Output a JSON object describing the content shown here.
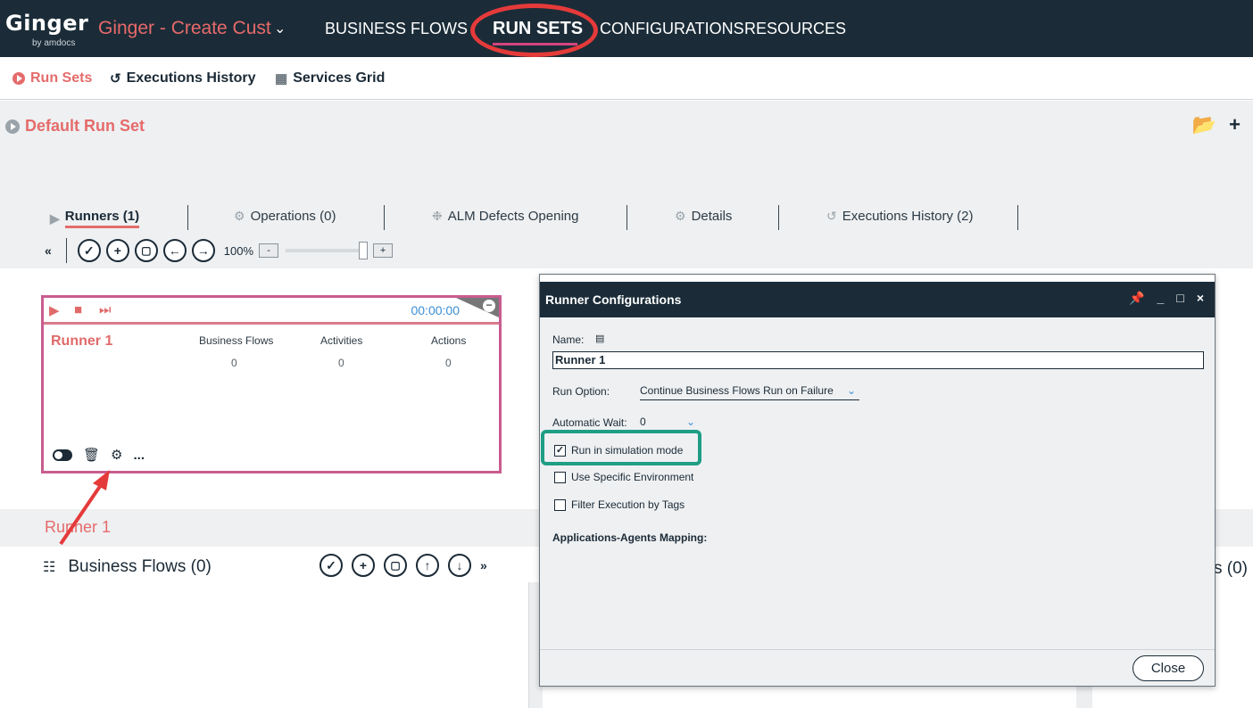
{
  "app": {
    "logo": "Ginger",
    "logo_sub": "by amdocs",
    "solution_name": "Ginger - Create Cust"
  },
  "topnav": {
    "items": [
      "BUSINESS FLOWS",
      "RUN SETS",
      "CONFIGURATIONS",
      "RESOURCES"
    ],
    "active": "RUN SETS"
  },
  "subnav": {
    "run_sets": "Run Sets",
    "executions_history": "Executions History",
    "services_grid": "Services Grid"
  },
  "runset": {
    "title": "Default Run Set"
  },
  "tabs": {
    "runners": "Runners (1)",
    "operations": "Operations (0)",
    "alm": "ALM Defects Opening",
    "details": "Details",
    "history": "Executions History (2)"
  },
  "toolbar": {
    "zoom": "100%",
    "zoom_minus": "-",
    "zoom_plus": "+"
  },
  "runner_card": {
    "time": "00:00:00",
    "name": "Runner 1",
    "stats": [
      {
        "label": "Business Flows",
        "value": "0"
      },
      {
        "label": "Activities",
        "value": "0"
      },
      {
        "label": "Actions",
        "value": "0"
      }
    ],
    "more": "..."
  },
  "lower": {
    "runner_label": "Runner 1",
    "business_flows": "Business Flows (0)",
    "right_partial": "s (0)"
  },
  "dialog": {
    "title": "Runner Configurations",
    "name_label": "Name:",
    "name_value": "Runner 1",
    "run_option_label": "Run Option:",
    "run_option_value": "Continue Business Flows Run on Failure",
    "auto_wait_label": "Automatic Wait:",
    "auto_wait_value": "0",
    "simulation_label": "Run in simulation mode",
    "simulation_checked": true,
    "specific_env_label": "Use Specific Environment",
    "specific_env_checked": false,
    "filter_tags_label": "Filter Execution by Tags",
    "filter_tags_checked": false,
    "apps_agents_label": "Applications-Agents Mapping:",
    "close_label": "Close"
  },
  "colors": {
    "header_bg": "#1b2c38",
    "accent_red": "#e56b6b",
    "highlight_red": "#e53a3a",
    "highlight_green": "#1e9e84",
    "runner_border": "#c95c8f",
    "time_blue": "#3b8ed6"
  }
}
